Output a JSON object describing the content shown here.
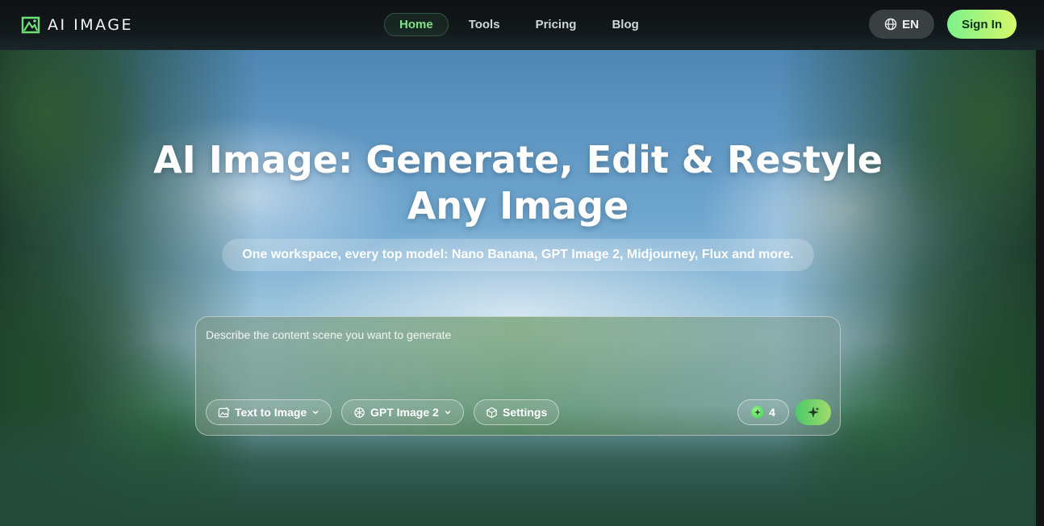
{
  "header": {
    "logo_text": "AI IMAGE",
    "nav": [
      {
        "label": "Home",
        "active": true
      },
      {
        "label": "Tools",
        "active": false
      },
      {
        "label": "Pricing",
        "active": false
      },
      {
        "label": "Blog",
        "active": false
      }
    ],
    "language_label": "EN",
    "signin_label": "Sign In"
  },
  "hero": {
    "title_line1": "AI Image: Generate, Edit & Restyle",
    "title_line2": "Any Image",
    "subtitle": "One workspace, every top model: Nano Banana, GPT Image 2, Midjourney, Flux and more."
  },
  "prompt": {
    "placeholder": "Describe the content scene you want to generate",
    "mode_label": "Text to Image",
    "model_label": "GPT Image 2",
    "settings_label": "Settings",
    "credits": "4"
  },
  "icons": {
    "logo": "image-frame-icon",
    "language": "globe-icon",
    "mode": "image-edit-icon",
    "model": "openai-icon",
    "settings": "cube-icon",
    "credit": "coin-icon",
    "generate": "sparkle-icon"
  },
  "colors": {
    "accent_green": "#7fe08a",
    "signin_gradient_start": "#7cf28c",
    "signin_gradient_end": "#d6f76a",
    "header_bg": "#0e1113"
  }
}
